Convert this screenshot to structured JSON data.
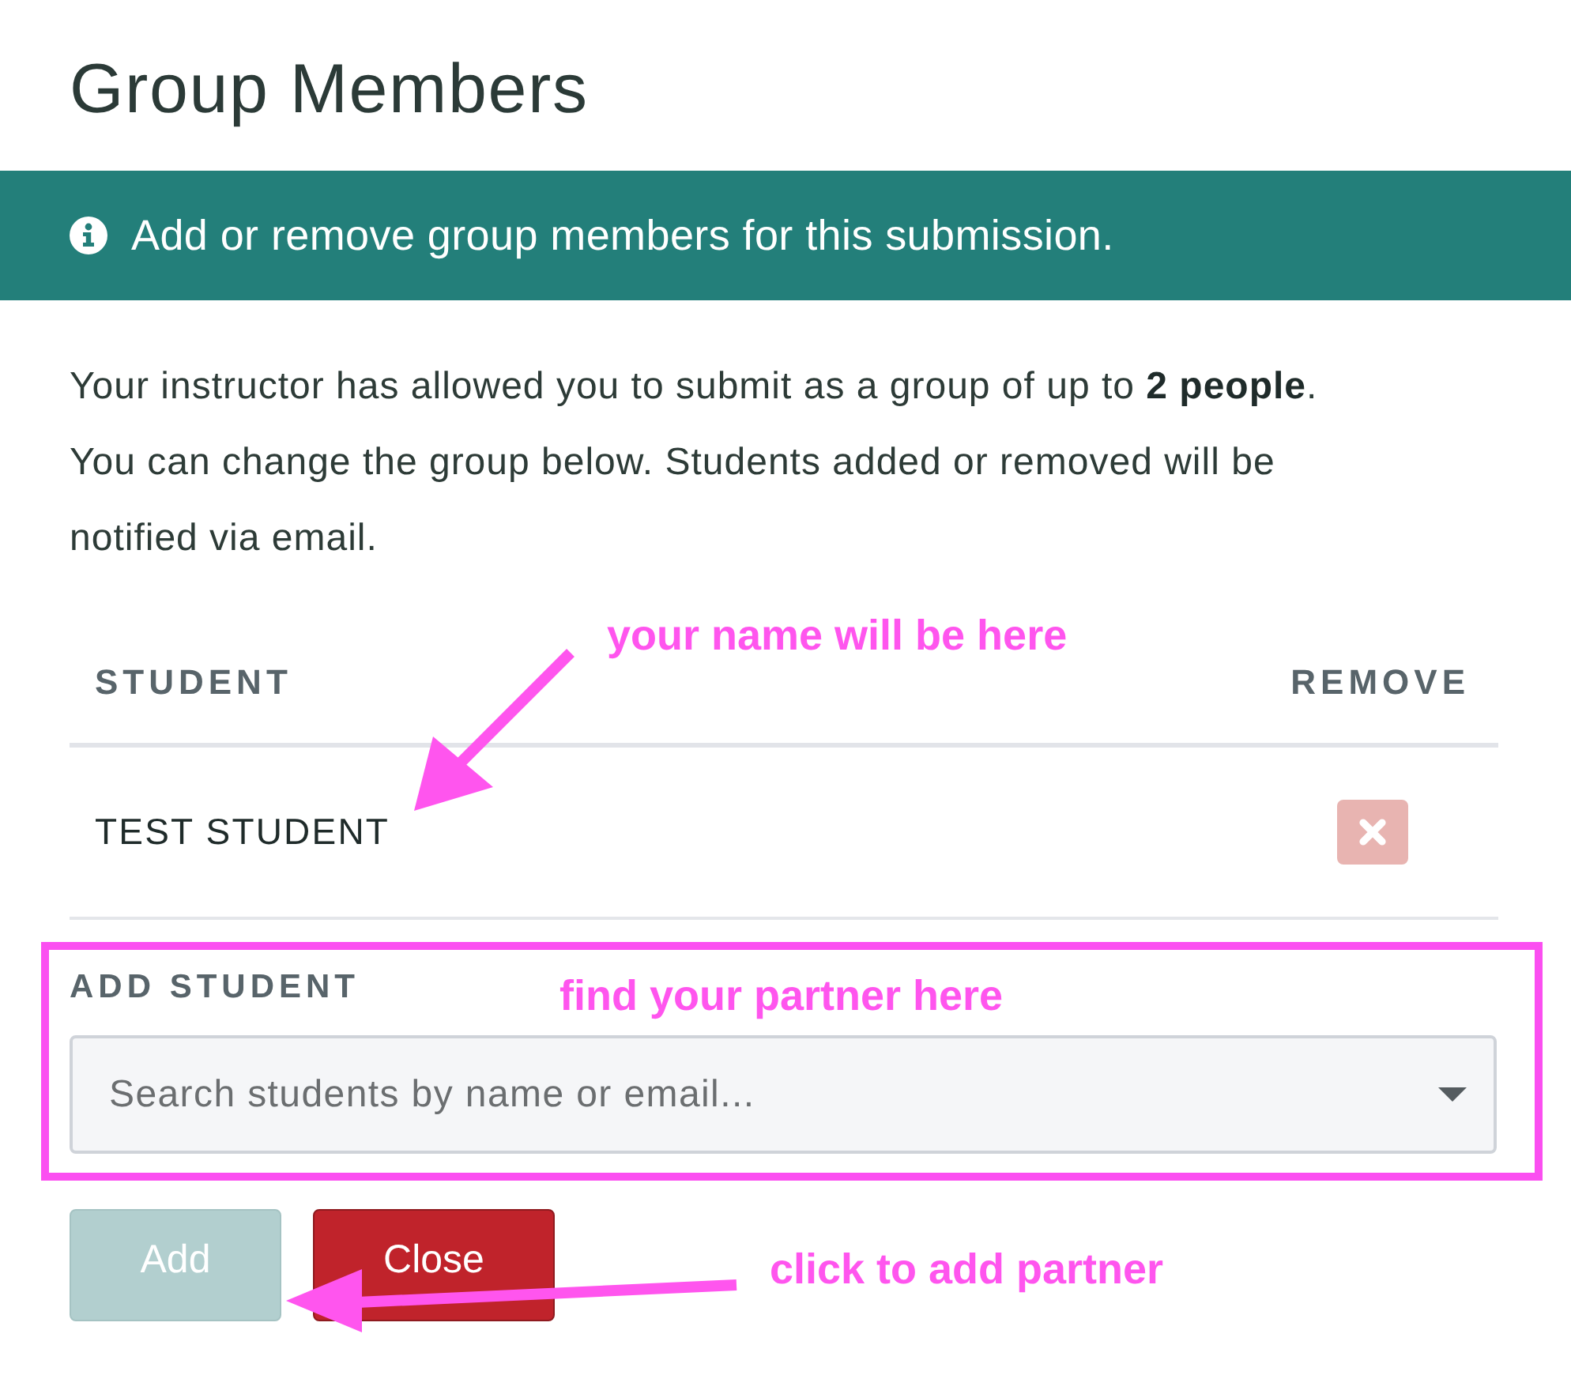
{
  "title": "Group Members",
  "banner": {
    "text": "Add or remove group members for this submission."
  },
  "intro": "Your instructor has allowed you to submit as a group of up to **2 people**. You can change the group below. Students added or removed will be notified via email.",
  "table": {
    "columns": [
      "STUDENT",
      "REMOVE"
    ],
    "rows": [
      {
        "student": "TEST STUDENT"
      }
    ]
  },
  "add_student": {
    "label": "ADD STUDENT",
    "search": {
      "placeholder": "Search students by name or email..."
    }
  },
  "buttons": [
    {
      "label": "Add",
      "kind": "primary",
      "disabled": true
    },
    {
      "label": "Close",
      "kind": "danger",
      "disabled": false
    }
  ],
  "annotations": [
    {
      "text": "your name will be here"
    },
    {
      "text": "find your partner here"
    },
    {
      "text": "click to add partner"
    }
  ]
}
